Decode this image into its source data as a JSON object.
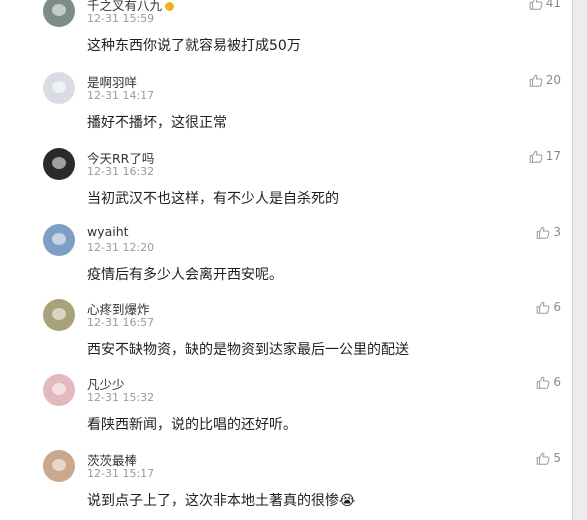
{
  "comments": [
    {
      "username": "千之叉有八九",
      "time": "12-31 15:59",
      "text": "这种东西你说了就容易被打成50万",
      "likes": "41",
      "avatar_color": "#7e8c86",
      "badge_color": "#f2b01e"
    },
    {
      "username": "是啊羽咩",
      "time": "12-31 14:17",
      "text": "播好不播坏，这很正常",
      "likes": "20",
      "avatar_color": "#d9dde3"
    },
    {
      "username": "今天RR了吗",
      "time": "12-31 16:32",
      "text": "当初武汉不也这样，有不少人是自杀死的",
      "likes": "17",
      "avatar_color": "#2a2a2a"
    },
    {
      "username": "wyaiht",
      "time": "12-31 12:20",
      "text": "疫情后有多少人会离开西安呢。",
      "likes": "3",
      "avatar_color": "#7d9fc4"
    },
    {
      "username": "心疼到爆炸",
      "time": "12-31 16:57",
      "text": "西安不缺物资，缺的是物资到达家最后一公里的配送",
      "likes": "6",
      "avatar_color": "#a8a27a"
    },
    {
      "username": "凡少少",
      "time": "12-31 15:32",
      "text": "看陕西新闻，说的比唱的还好听。",
      "likes": "6",
      "avatar_color": "#e3b9bd"
    },
    {
      "username": "茨茨最棒",
      "time": "12-31 15:17",
      "text": "说到点子上了，这次非本地土著真的很惨😭",
      "likes": "5",
      "avatar_color": "#c9a88e"
    }
  ]
}
